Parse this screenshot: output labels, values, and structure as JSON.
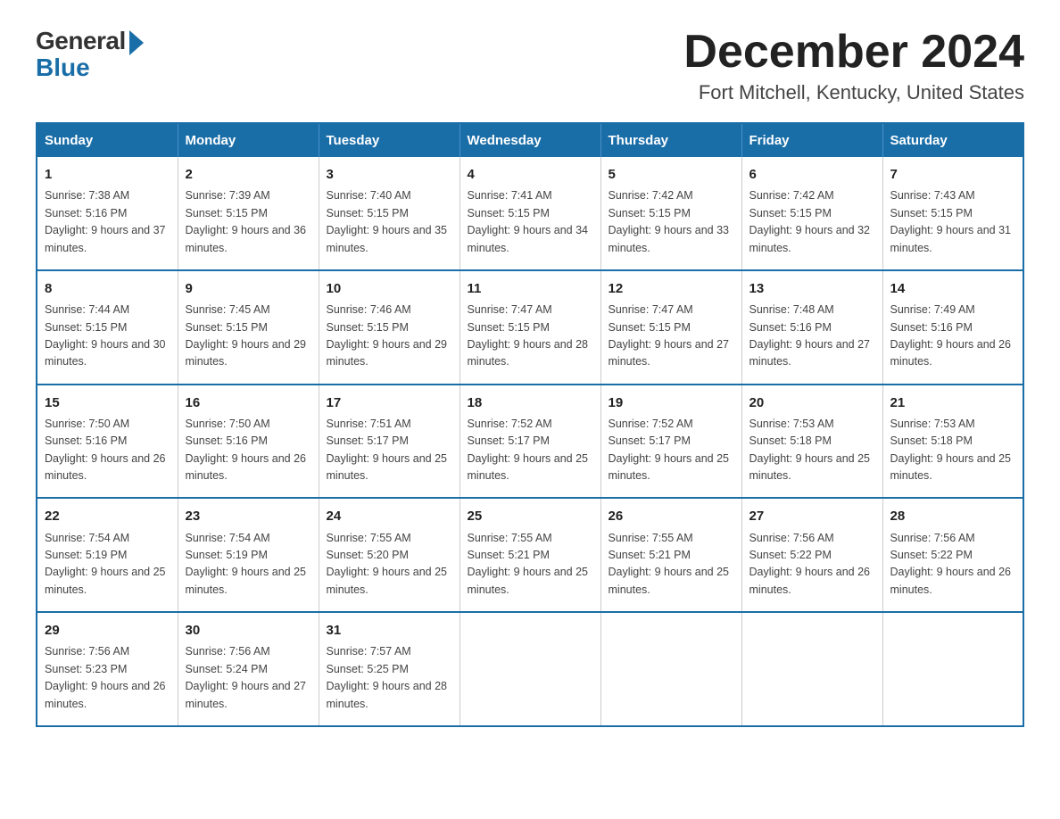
{
  "logo": {
    "general": "General",
    "blue": "Blue"
  },
  "title": {
    "month_year": "December 2024",
    "location": "Fort Mitchell, Kentucky, United States"
  },
  "days_of_week": [
    "Sunday",
    "Monday",
    "Tuesday",
    "Wednesday",
    "Thursday",
    "Friday",
    "Saturday"
  ],
  "weeks": [
    [
      {
        "day": "1",
        "sunrise": "7:38 AM",
        "sunset": "5:16 PM",
        "daylight": "9 hours and 37 minutes."
      },
      {
        "day": "2",
        "sunrise": "7:39 AM",
        "sunset": "5:15 PM",
        "daylight": "9 hours and 36 minutes."
      },
      {
        "day": "3",
        "sunrise": "7:40 AM",
        "sunset": "5:15 PM",
        "daylight": "9 hours and 35 minutes."
      },
      {
        "day": "4",
        "sunrise": "7:41 AM",
        "sunset": "5:15 PM",
        "daylight": "9 hours and 34 minutes."
      },
      {
        "day": "5",
        "sunrise": "7:42 AM",
        "sunset": "5:15 PM",
        "daylight": "9 hours and 33 minutes."
      },
      {
        "day": "6",
        "sunrise": "7:42 AM",
        "sunset": "5:15 PM",
        "daylight": "9 hours and 32 minutes."
      },
      {
        "day": "7",
        "sunrise": "7:43 AM",
        "sunset": "5:15 PM",
        "daylight": "9 hours and 31 minutes."
      }
    ],
    [
      {
        "day": "8",
        "sunrise": "7:44 AM",
        "sunset": "5:15 PM",
        "daylight": "9 hours and 30 minutes."
      },
      {
        "day": "9",
        "sunrise": "7:45 AM",
        "sunset": "5:15 PM",
        "daylight": "9 hours and 29 minutes."
      },
      {
        "day": "10",
        "sunrise": "7:46 AM",
        "sunset": "5:15 PM",
        "daylight": "9 hours and 29 minutes."
      },
      {
        "day": "11",
        "sunrise": "7:47 AM",
        "sunset": "5:15 PM",
        "daylight": "9 hours and 28 minutes."
      },
      {
        "day": "12",
        "sunrise": "7:47 AM",
        "sunset": "5:15 PM",
        "daylight": "9 hours and 27 minutes."
      },
      {
        "day": "13",
        "sunrise": "7:48 AM",
        "sunset": "5:16 PM",
        "daylight": "9 hours and 27 minutes."
      },
      {
        "day": "14",
        "sunrise": "7:49 AM",
        "sunset": "5:16 PM",
        "daylight": "9 hours and 26 minutes."
      }
    ],
    [
      {
        "day": "15",
        "sunrise": "7:50 AM",
        "sunset": "5:16 PM",
        "daylight": "9 hours and 26 minutes."
      },
      {
        "day": "16",
        "sunrise": "7:50 AM",
        "sunset": "5:16 PM",
        "daylight": "9 hours and 26 minutes."
      },
      {
        "day": "17",
        "sunrise": "7:51 AM",
        "sunset": "5:17 PM",
        "daylight": "9 hours and 25 minutes."
      },
      {
        "day": "18",
        "sunrise": "7:52 AM",
        "sunset": "5:17 PM",
        "daylight": "9 hours and 25 minutes."
      },
      {
        "day": "19",
        "sunrise": "7:52 AM",
        "sunset": "5:17 PM",
        "daylight": "9 hours and 25 minutes."
      },
      {
        "day": "20",
        "sunrise": "7:53 AM",
        "sunset": "5:18 PM",
        "daylight": "9 hours and 25 minutes."
      },
      {
        "day": "21",
        "sunrise": "7:53 AM",
        "sunset": "5:18 PM",
        "daylight": "9 hours and 25 minutes."
      }
    ],
    [
      {
        "day": "22",
        "sunrise": "7:54 AM",
        "sunset": "5:19 PM",
        "daylight": "9 hours and 25 minutes."
      },
      {
        "day": "23",
        "sunrise": "7:54 AM",
        "sunset": "5:19 PM",
        "daylight": "9 hours and 25 minutes."
      },
      {
        "day": "24",
        "sunrise": "7:55 AM",
        "sunset": "5:20 PM",
        "daylight": "9 hours and 25 minutes."
      },
      {
        "day": "25",
        "sunrise": "7:55 AM",
        "sunset": "5:21 PM",
        "daylight": "9 hours and 25 minutes."
      },
      {
        "day": "26",
        "sunrise": "7:55 AM",
        "sunset": "5:21 PM",
        "daylight": "9 hours and 25 minutes."
      },
      {
        "day": "27",
        "sunrise": "7:56 AM",
        "sunset": "5:22 PM",
        "daylight": "9 hours and 26 minutes."
      },
      {
        "day": "28",
        "sunrise": "7:56 AM",
        "sunset": "5:22 PM",
        "daylight": "9 hours and 26 minutes."
      }
    ],
    [
      {
        "day": "29",
        "sunrise": "7:56 AM",
        "sunset": "5:23 PM",
        "daylight": "9 hours and 26 minutes."
      },
      {
        "day": "30",
        "sunrise": "7:56 AM",
        "sunset": "5:24 PM",
        "daylight": "9 hours and 27 minutes."
      },
      {
        "day": "31",
        "sunrise": "7:57 AM",
        "sunset": "5:25 PM",
        "daylight": "9 hours and 28 minutes."
      },
      null,
      null,
      null,
      null
    ]
  ]
}
